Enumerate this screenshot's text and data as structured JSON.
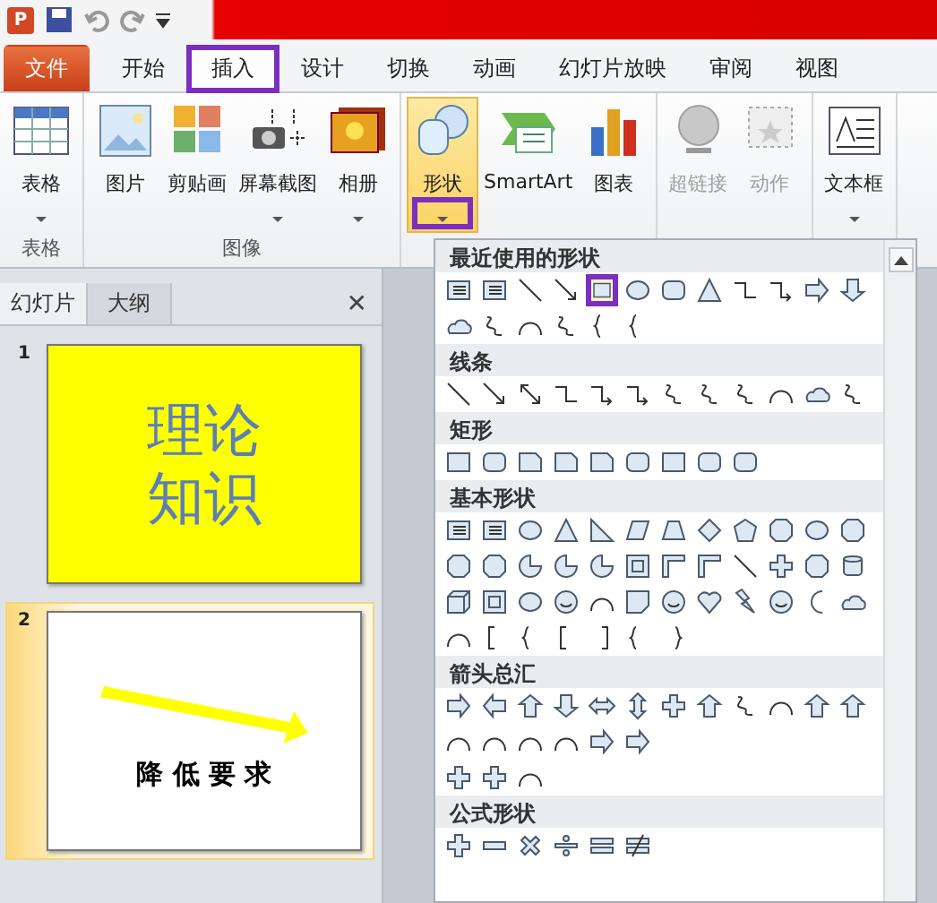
{
  "quick_access": {
    "app_icon": "P"
  },
  "tabs": [
    {
      "label": "文件",
      "kind": "file",
      "selected": false,
      "annotated": false
    },
    {
      "label": "开始",
      "kind": "tab",
      "selected": false,
      "annotated": false
    },
    {
      "label": "插入",
      "kind": "tab",
      "selected": true,
      "annotated": true
    },
    {
      "label": "设计",
      "kind": "tab",
      "selected": false,
      "annotated": false
    },
    {
      "label": "切换",
      "kind": "tab",
      "selected": false,
      "annotated": false
    },
    {
      "label": "动画",
      "kind": "tab",
      "selected": false,
      "annotated": false
    },
    {
      "label": "幻灯片放映",
      "kind": "tab",
      "selected": false,
      "annotated": false
    },
    {
      "label": "审阅",
      "kind": "tab",
      "selected": false,
      "annotated": false
    },
    {
      "label": "视图",
      "kind": "tab",
      "selected": false,
      "annotated": false
    }
  ],
  "ribbon_groups": [
    {
      "label": "表格",
      "buttons": [
        {
          "label": "表格",
          "kind": "table",
          "dropdown": true,
          "disabled": false,
          "pressed": false,
          "annotated": false
        }
      ]
    },
    {
      "label": "图像",
      "buttons": [
        {
          "label": "图片",
          "kind": "picture",
          "dropdown": false,
          "disabled": false,
          "pressed": false,
          "annotated": false
        },
        {
          "label": "剪贴画",
          "kind": "clipart",
          "dropdown": false,
          "disabled": false,
          "pressed": false,
          "annotated": false
        },
        {
          "label": "屏幕截图",
          "kind": "screenshot",
          "dropdown": true,
          "disabled": false,
          "pressed": false,
          "annotated": false
        },
        {
          "label": "相册",
          "kind": "album",
          "dropdown": true,
          "disabled": false,
          "pressed": false,
          "annotated": false
        }
      ]
    },
    {
      "buttons": [
        {
          "label": "形状",
          "kind": "shapes",
          "dropdown": true,
          "disabled": false,
          "pressed": true,
          "annotated": true
        },
        {
          "label": "SmartArt",
          "kind": "smartart",
          "dropdown": false,
          "disabled": false,
          "pressed": false,
          "annotated": false
        },
        {
          "label": "图表",
          "kind": "chart",
          "dropdown": false,
          "disabled": false,
          "pressed": false,
          "annotated": false
        }
      ]
    },
    {
      "buttons": [
        {
          "label": "超链接",
          "kind": "link",
          "dropdown": false,
          "disabled": true,
          "pressed": false,
          "annotated": false
        },
        {
          "label": "动作",
          "kind": "action",
          "dropdown": false,
          "disabled": true,
          "pressed": false,
          "annotated": false
        }
      ]
    },
    {
      "buttons": [
        {
          "label": "文本框",
          "kind": "textbox",
          "dropdown": true,
          "disabled": false,
          "pressed": false,
          "annotated": false
        }
      ]
    }
  ],
  "side_pane": {
    "tabs": [
      {
        "label": "幻灯片",
        "selected": true
      },
      {
        "label": "大纲",
        "selected": false
      }
    ],
    "close": "✕"
  },
  "slides": [
    {
      "number": "1",
      "kind": "title",
      "text": "理论知识",
      "selected": false
    },
    {
      "number": "2",
      "kind": "arrow",
      "text": "降 低 要 求",
      "selected": true
    }
  ],
  "shape_gallery": {
    "sections": [
      {
        "title": "最近使用的形状",
        "rows": [
          [
            {
              "kind": "textbox"
            },
            {
              "kind": "vtextbox"
            },
            {
              "kind": "line"
            },
            {
              "kind": "arrowline"
            },
            {
              "kind": "rect",
              "selected": true,
              "annotated": true
            },
            {
              "kind": "oval"
            },
            {
              "kind": "roundrect"
            },
            {
              "kind": "triangle"
            },
            {
              "kind": "elbow"
            },
            {
              "kind": "elbowarrow"
            },
            {
              "kind": "rightarrow"
            },
            {
              "kind": "downarrow"
            }
          ],
          [
            {
              "kind": "freeform"
            },
            {
              "kind": "scribble"
            },
            {
              "kind": "arc"
            },
            {
              "kind": "curve"
            },
            {
              "kind": "brace"
            },
            {
              "kind": "brace"
            }
          ]
        ]
      },
      {
        "title": "线条",
        "rows": [
          [
            {
              "kind": "line"
            },
            {
              "kind": "arrowline"
            },
            {
              "kind": "doublearrow"
            },
            {
              "kind": "elbow"
            },
            {
              "kind": "elbowarrow"
            },
            {
              "kind": "elbowarrow"
            },
            {
              "kind": "curve"
            },
            {
              "kind": "curve"
            },
            {
              "kind": "curve"
            },
            {
              "kind": "arc"
            },
            {
              "kind": "freeform"
            },
            {
              "kind": "scribble"
            }
          ]
        ]
      },
      {
        "title": "矩形",
        "rows": [
          [
            {
              "kind": "rect"
            },
            {
              "kind": "roundrect"
            },
            {
              "kind": "snip"
            },
            {
              "kind": "snip"
            },
            {
              "kind": "snip"
            },
            {
              "kind": "roundrect"
            },
            {
              "kind": "rect"
            },
            {
              "kind": "roundrect"
            },
            {
              "kind": "roundrect"
            }
          ]
        ]
      },
      {
        "title": "基本形状",
        "rows": [
          [
            {
              "kind": "textbox"
            },
            {
              "kind": "vtextbox"
            },
            {
              "kind": "oval"
            },
            {
              "kind": "triangle"
            },
            {
              "kind": "righttriangle"
            },
            {
              "kind": "parallelogram"
            },
            {
              "kind": "trapezoid"
            },
            {
              "kind": "diamond"
            },
            {
              "kind": "pentagon"
            },
            {
              "kind": "hexagon"
            },
            {
              "kind": "oval"
            },
            {
              "kind": "octagon"
            }
          ],
          [
            {
              "kind": "octagon"
            },
            {
              "kind": "octagon"
            },
            {
              "kind": "pie"
            },
            {
              "kind": "chord"
            },
            {
              "kind": "teardrop"
            },
            {
              "kind": "frame"
            },
            {
              "kind": "halfframe"
            },
            {
              "kind": "lshape"
            },
            {
              "kind": "diagonal"
            },
            {
              "kind": "plus"
            },
            {
              "kind": "octagon"
            },
            {
              "kind": "can"
            }
          ],
          [
            {
              "kind": "cube"
            },
            {
              "kind": "bevel"
            },
            {
              "kind": "donut"
            },
            {
              "kind": "nosymbol"
            },
            {
              "kind": "blockarc"
            },
            {
              "kind": "foldedcorner"
            },
            {
              "kind": "smiley"
            },
            {
              "kind": "heart"
            },
            {
              "kind": "lightning"
            },
            {
              "kind": "sun"
            },
            {
              "kind": "moon"
            },
            {
              "kind": "cloud"
            }
          ],
          [
            {
              "kind": "arc"
            },
            {
              "kind": "bracketpair"
            },
            {
              "kind": "bracepair"
            },
            {
              "kind": "leftbracket"
            },
            {
              "kind": "rightbracket"
            },
            {
              "kind": "leftbrace"
            },
            {
              "kind": "rightbrace"
            }
          ]
        ]
      },
      {
        "title": "箭头总汇",
        "rows": [
          [
            {
              "kind": "rightarrow"
            },
            {
              "kind": "leftarrow"
            },
            {
              "kind": "uparrow"
            },
            {
              "kind": "downarrow"
            },
            {
              "kind": "lrarrow"
            },
            {
              "kind": "udarrow"
            },
            {
              "kind": "quadarrow"
            },
            {
              "kind": "uparrow"
            },
            {
              "kind": "curve"
            },
            {
              "kind": "arc"
            },
            {
              "kind": "uparrow"
            },
            {
              "kind": "uparrow"
            }
          ],
          [
            {
              "kind": "arc"
            },
            {
              "kind": "arc"
            },
            {
              "kind": "arc"
            },
            {
              "kind": "arc"
            },
            {
              "kind": "rightarrow"
            },
            {
              "kind": "rightarrow"
            }
          ],
          [
            {
              "kind": "quadarrow"
            },
            {
              "kind": "quadarrow"
            },
            {
              "kind": "arc"
            }
          ]
        ]
      },
      {
        "title": "公式形状",
        "rows": [
          [
            {
              "kind": "plus"
            },
            {
              "kind": "minus"
            },
            {
              "kind": "times"
            },
            {
              "kind": "divide"
            },
            {
              "kind": "equal"
            },
            {
              "kind": "notequal"
            }
          ]
        ]
      }
    ]
  }
}
